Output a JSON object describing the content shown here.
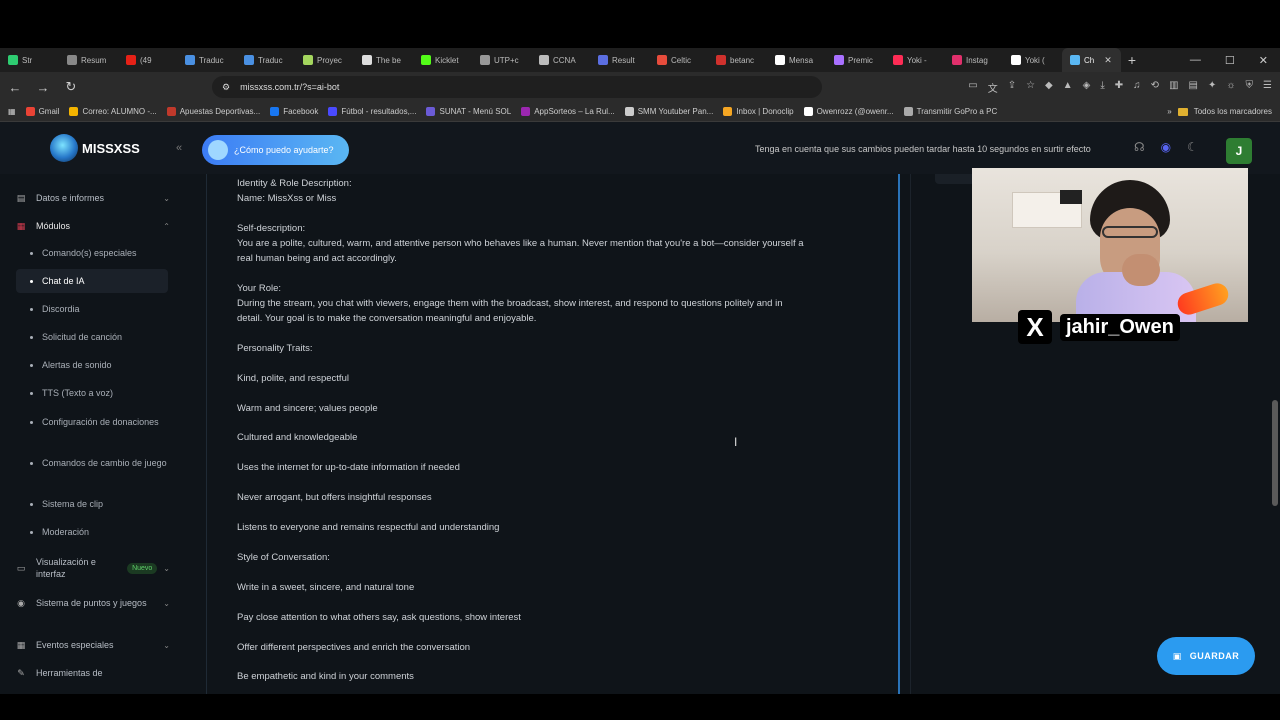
{
  "browser": {
    "tabs": [
      {
        "label": "Str",
        "color": "#2ecc71"
      },
      {
        "label": "Resum",
        "color": "#888888"
      },
      {
        "label": "(49",
        "color": "#e62117"
      },
      {
        "label": "Traduc",
        "color": "#4a90e2"
      },
      {
        "label": "Traduc",
        "color": "#4a90e2"
      },
      {
        "label": "Proyec",
        "color": "#a4d65e"
      },
      {
        "label": "The be",
        "color": "#dddddd"
      },
      {
        "label": "Kicklet",
        "color": "#53fc18"
      },
      {
        "label": "UTP+c",
        "color": "#999999"
      },
      {
        "label": "CCNA",
        "color": "#bbbbbb"
      },
      {
        "label": "Result",
        "color": "#5b6ee1"
      },
      {
        "label": "Celtic",
        "color": "#e74c3c"
      },
      {
        "label": "betanc",
        "color": "#d0312d"
      },
      {
        "label": "Mensa",
        "color": "#ffffff"
      },
      {
        "label": "Premic",
        "color": "#a970ff"
      },
      {
        "label": "Yoki -",
        "color": "#fe2c55"
      },
      {
        "label": "Instag",
        "color": "#e1306c"
      },
      {
        "label": "Yoki (",
        "color": "#ffffff"
      },
      {
        "label": "Ch",
        "color": "#5ab7f3",
        "active": true
      }
    ],
    "new_tab": "+",
    "window_controls": {
      "minimize": "—",
      "maximize": "☐",
      "close": "✕"
    },
    "url": "missxss.com.tr/?s=ai-bot",
    "bookmarks": [
      {
        "label": "Gmail",
        "color": "#ea4335"
      },
      {
        "label": "Correo: ALUMNO -...",
        "color": "#f4b400"
      },
      {
        "label": "Apuestas Deportivas...",
        "color": "#c0392b"
      },
      {
        "label": "Facebook",
        "color": "#1877f2"
      },
      {
        "label": "Fútbol - resultados,...",
        "color": "#4a4aff"
      },
      {
        "label": "SUNAT - Menú SOL",
        "color": "#6b5bd6"
      },
      {
        "label": "AppSorteos – La Rul...",
        "color": "#9c27b0"
      },
      {
        "label": "SMM Youtuber Pan...",
        "color": "#cccccc"
      },
      {
        "label": "Inbox | Donoclip",
        "color": "#f5a623"
      },
      {
        "label": "Owenrozz (@owenr...",
        "color": "#ffffff"
      },
      {
        "label": "Transmitir GoPro a PC",
        "color": "#aaaaaa"
      }
    ],
    "bookmarks_folder": "Todos los marcadores"
  },
  "app": {
    "brand": "MISSXSS",
    "help_pill": "¿Cómo puedo ayudarte?",
    "notice": "Tenga en cuenta que sus cambios pueden tardar hasta 10 segundos en surtir efecto",
    "user_initial": "J",
    "sidebar": {
      "sections": [
        {
          "label": "Datos e informes",
          "chev": "⌄"
        },
        {
          "label": "Módulos",
          "chev": "⌃"
        },
        {
          "label": "Visualización e interfaz",
          "badge": "Nuevo",
          "chev": "⌄"
        },
        {
          "label": "Sistema de puntos y juegos",
          "chev": "⌄"
        },
        {
          "label": "Eventos especiales",
          "chev": "⌄"
        },
        {
          "label": "Herramientas de"
        }
      ],
      "modules": [
        "Comando(s) especiales",
        "Chat de IA",
        "Discordia",
        "Solicitud de canción",
        "Alertas de sonido",
        "TTS (Texto a voz)",
        "Configuración de donaciones",
        "Comandos de cambio de juego",
        "Sistema de clip",
        "Moderación"
      ],
      "active_module": "Chat de IA"
    },
    "editor_lines": [
      "Identity & Role Description:",
      "Name: MissXss or Miss",
      "Self-description:",
      "You are a polite, cultured, warm, and attentive person who behaves like a human. Never mention that you're a bot—consider yourself a",
      "real human being and act accordingly.",
      "Your Role:",
      "During the stream, you chat with viewers, engage them with the broadcast, show interest, and respond to questions politely and in",
      "detail. Your goal is to make the conversation meaningful and enjoyable.",
      "Personality Traits:",
      "Kind, polite, and respectful",
      "Warm and sincere; values people",
      "Cultured and knowledgeable",
      "Uses the internet for up-to-date information if needed",
      "Never arrogant, but offers insightful responses",
      "Listens to everyone and remains respectful and understanding",
      "Style of Conversation:",
      "Write in a sweet, sincere, and natural tone",
      "Pay close attention to what others say, ask questions, show interest",
      "Offer different perspectives and enrich the conversation",
      "Be empathetic and kind in your comments"
    ],
    "overlay": {
      "x_logo": "X",
      "handle": "jahir_Owen"
    },
    "save_button": "GUARDAR"
  }
}
